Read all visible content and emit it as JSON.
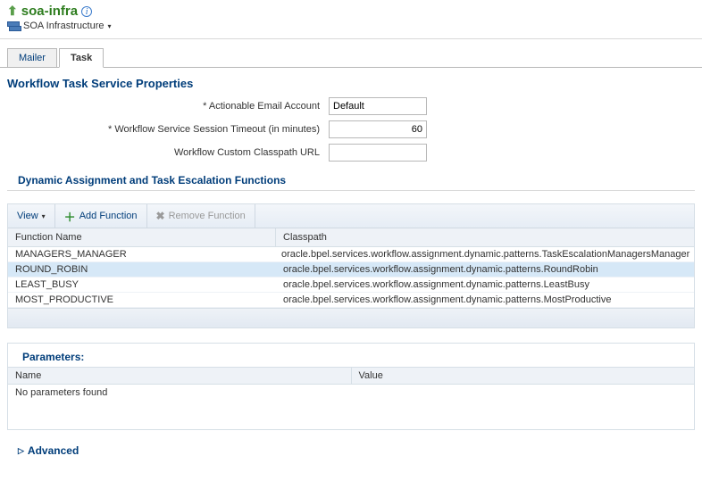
{
  "header": {
    "title": "soa-infra",
    "subtitle": "SOA Infrastructure"
  },
  "tabs": {
    "items": [
      "Mailer",
      "Task"
    ],
    "active": 1
  },
  "section_title": "Workflow Task Service Properties",
  "form": {
    "email_label": "* Actionable Email Account",
    "email_value": "Default",
    "timeout_label": "* Workflow Service Session Timeout (in minutes)",
    "timeout_value": "60",
    "classpath_label": "Workflow Custom Classpath URL",
    "classpath_value": ""
  },
  "subsection_title": "Dynamic Assignment and Task Escalation Functions",
  "toolbar": {
    "view_label": "View",
    "add_label": "Add Function",
    "remove_label": "Remove Function"
  },
  "table": {
    "headers": {
      "name": "Function Name",
      "classpath": "Classpath"
    },
    "rows": [
      {
        "name": "MANAGERS_MANAGER",
        "classpath": "oracle.bpel.services.workflow.assignment.dynamic.patterns.TaskEscalationManagersManager",
        "selected": false
      },
      {
        "name": "ROUND_ROBIN",
        "classpath": "oracle.bpel.services.workflow.assignment.dynamic.patterns.RoundRobin",
        "selected": true
      },
      {
        "name": "LEAST_BUSY",
        "classpath": "oracle.bpel.services.workflow.assignment.dynamic.patterns.LeastBusy",
        "selected": false
      },
      {
        "name": "MOST_PRODUCTIVE",
        "classpath": "oracle.bpel.services.workflow.assignment.dynamic.patterns.MostProductive",
        "selected": false
      }
    ]
  },
  "params": {
    "title": "Parameters:",
    "headers": {
      "name": "Name",
      "value": "Value"
    },
    "empty_text": "No parameters found"
  },
  "advanced_label": "Advanced"
}
